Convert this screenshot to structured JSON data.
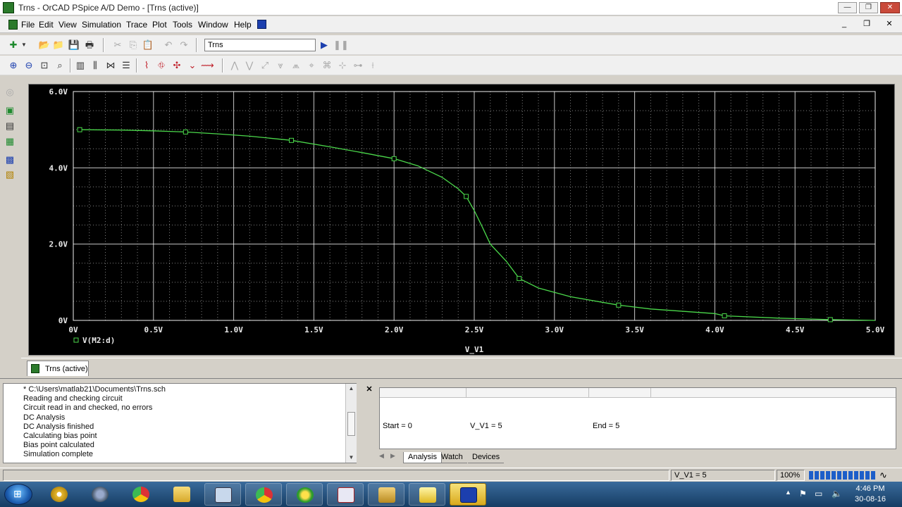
{
  "window": {
    "title": "Trns - OrCAD PSpice A/D Demo - [Trns (active)]",
    "min_btn": "—",
    "max_btn": "❐",
    "close_btn": "✕"
  },
  "menubar": {
    "items": [
      "File",
      "Edit",
      "View",
      "Simulation",
      "Trace",
      "Plot",
      "Tools",
      "Window",
      "Help"
    ],
    "mdi_min": "_",
    "mdi_restore": "❐",
    "mdi_close": "✕"
  },
  "toolbar": {
    "profile_value": "Trns"
  },
  "plot": {
    "x_axis_label": "V_V1",
    "trace_legend": "V(M2:d)",
    "x_ticks": [
      "0V",
      "0.5V",
      "1.0V",
      "1.5V",
      "2.0V",
      "2.5V",
      "3.0V",
      "3.5V",
      "4.0V",
      "4.5V",
      "5.0V"
    ],
    "y_ticks": [
      "0V",
      "2.0V",
      "4.0V",
      "6.0V"
    ],
    "trace_color": "#4bd84b",
    "grid_color": "#e8e8e8",
    "background_color": "#000000"
  },
  "chart_data": {
    "type": "line",
    "title": "",
    "xlabel": "V_V1",
    "ylabel": "",
    "xlim": [
      0,
      5
    ],
    "ylim": [
      0,
      6
    ],
    "grid": true,
    "legend_position": "bottom-left",
    "series": [
      {
        "name": "V(M2:d)",
        "x": [
          0.04,
          0.3,
          0.5,
          0.7,
          0.9,
          1.1,
          1.36,
          1.6,
          1.8,
          2.0,
          2.15,
          2.3,
          2.4,
          2.45,
          2.5,
          2.55,
          2.6,
          2.7,
          2.78,
          2.9,
          3.1,
          3.4,
          3.6,
          4.0,
          4.06,
          4.4,
          4.72,
          5.0
        ],
        "y": [
          5.0,
          4.99,
          4.97,
          4.94,
          4.89,
          4.83,
          4.72,
          4.55,
          4.4,
          4.24,
          4.05,
          3.75,
          3.45,
          3.25,
          2.88,
          2.45,
          2.0,
          1.55,
          1.1,
          0.85,
          0.62,
          0.4,
          0.3,
          0.18,
          0.12,
          0.06,
          0.02,
          0.0
        ],
        "marker_x": [
          0.04,
          0.7,
          1.36,
          2.0,
          2.45,
          2.78,
          3.4,
          4.06,
          4.72
        ]
      }
    ]
  },
  "doc_tab": {
    "label": "Trns (active)"
  },
  "output": {
    "lines": [
      "* C:\\Users\\matlab21\\Documents\\Trns.sch",
      "Reading and checking circuit",
      "Circuit read in and checked, no errors",
      "DC Analysis",
      "DC Analysis finished",
      "Calculating bias point",
      "Bias point calculated",
      "Simulation complete"
    ]
  },
  "sim_status": {
    "start": "Start = 0",
    "current": "V_V1 =  5",
    "end": "End = 5",
    "tabs": [
      "Analysis",
      "Watch",
      "Devices"
    ]
  },
  "statusbar": {
    "sweep_value": "V_V1 =  5",
    "zoom": "100%",
    "progress": 1.0
  },
  "taskbar": {
    "clock_time": "4:46 PM",
    "clock_date": "30-08-16"
  },
  "colors": {
    "taskbar": "#1f4a77",
    "accent_blue": "#1c5ec9",
    "window_face": "#d4d0c8"
  }
}
